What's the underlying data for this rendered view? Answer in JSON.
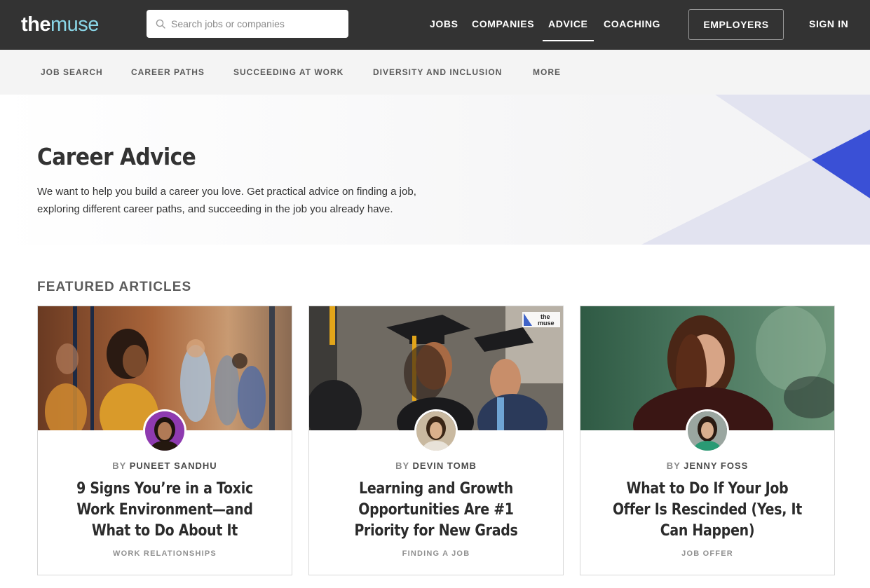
{
  "header": {
    "logo_the": "the",
    "logo_muse": "muse",
    "search_placeholder": "Search jobs or companies",
    "nav": [
      "JOBS",
      "COMPANIES",
      "ADVICE",
      "COACHING"
    ],
    "active_nav": "ADVICE",
    "employers_label": "EMPLOYERS",
    "signin_label": "SIGN IN"
  },
  "subnav": [
    "JOB SEARCH",
    "CAREER PATHS",
    "SUCCEEDING AT WORK",
    "DIVERSITY AND INCLUSION",
    "MORE"
  ],
  "hero": {
    "title": "Career Advice",
    "description": "We want to help you build a career you love. Get practical advice on finding a job, exploring different career paths, and succeeding in the job you already have."
  },
  "featured": {
    "heading": "FEATURED ARTICLES",
    "by_prefix": "BY",
    "cards": [
      {
        "author": "PUNEET SANDHU",
        "title": "9 Signs You’re in a Toxic Work Environment—and What to Do About It",
        "tag": "WORK RELATIONSHIPS"
      },
      {
        "author": "DEVIN TOMB",
        "title": "Learning and Growth Opportunities Are #1 Priority for New Grads",
        "tag": "FINDING A JOB",
        "badge_line1": "the",
        "badge_line2": "muse"
      },
      {
        "author": "JENNY FOSS",
        "title": "What to Do If Your Job Offer Is Rescinded (Yes, It Can Happen)",
        "tag": "JOB OFFER"
      }
    ]
  },
  "colors": {
    "topbar": "#333333",
    "logo_accent": "#8ad7e8",
    "hero_accent": "#3a50d6",
    "hero_shape": "#e2e3f0"
  },
  "icons": {
    "search": "search-icon"
  }
}
